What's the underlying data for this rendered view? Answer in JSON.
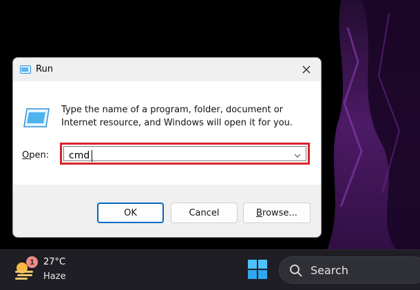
{
  "dialog": {
    "title": "Run",
    "description": "Type the name of a program, folder, document or Internet resource, and Windows will open it for you.",
    "open_label_prefix": "",
    "open_label_accel": "O",
    "open_label_rest": "pen:",
    "input_value": "cmd",
    "ok_label": "OK",
    "cancel_label": "Cancel",
    "browse_accel": "B",
    "browse_rest": "rowse...",
    "highlight_color": "#d9222b"
  },
  "taskbar": {
    "weather_badge": "1",
    "temperature": "27°C",
    "condition": "Haze",
    "search_label": "Search"
  }
}
